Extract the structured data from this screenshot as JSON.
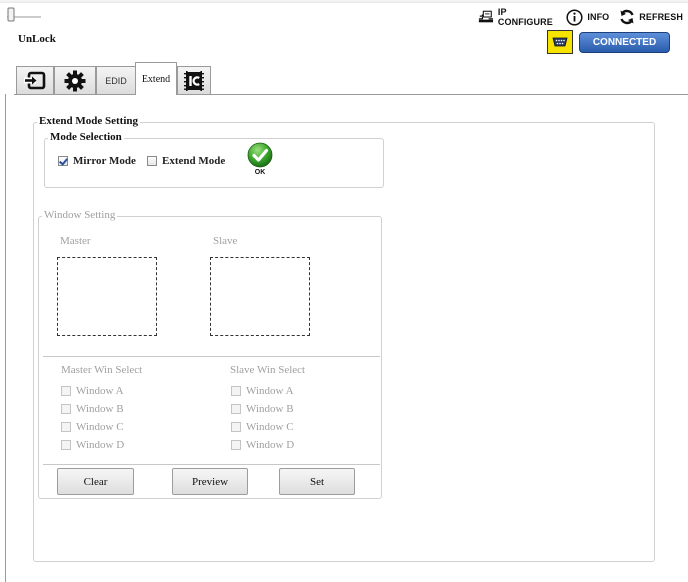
{
  "header": {
    "lock_label": "UnLock",
    "ip_configure": "IP CONFIGURE",
    "info": "INFO",
    "refresh": "REFRESH",
    "connection_status": "CONNECTED"
  },
  "tabs": [
    {
      "label": "",
      "icon": "input-icon"
    },
    {
      "label": "",
      "icon": "gear-icon"
    },
    {
      "label": "EDID"
    },
    {
      "label": "Extend",
      "active": true
    },
    {
      "label": "",
      "icon": "ic-chip-icon"
    }
  ],
  "extend": {
    "title": "Extend Mode Setting",
    "mode_selection": {
      "title": "Mode Selection",
      "mirror_label": "Mirror Mode",
      "mirror_checked": true,
      "extend_label": "Extend Mode",
      "extend_checked": false,
      "ok_label": "OK"
    },
    "window_setting": {
      "title": "Window Setting",
      "master_label": "Master",
      "slave_label": "Slave",
      "master_select_title": "Master Win Select",
      "slave_select_title": "Slave Win Select",
      "windows": [
        "Window A",
        "Window B",
        "Window C",
        "Window D"
      ],
      "buttons": {
        "clear": "Clear",
        "preview": "Preview",
        "set": "Set"
      }
    }
  },
  "colors": {
    "connected_bg": "#3a6cbf",
    "serial_bg": "#f6e400",
    "ok_green": "#3aa52b"
  }
}
